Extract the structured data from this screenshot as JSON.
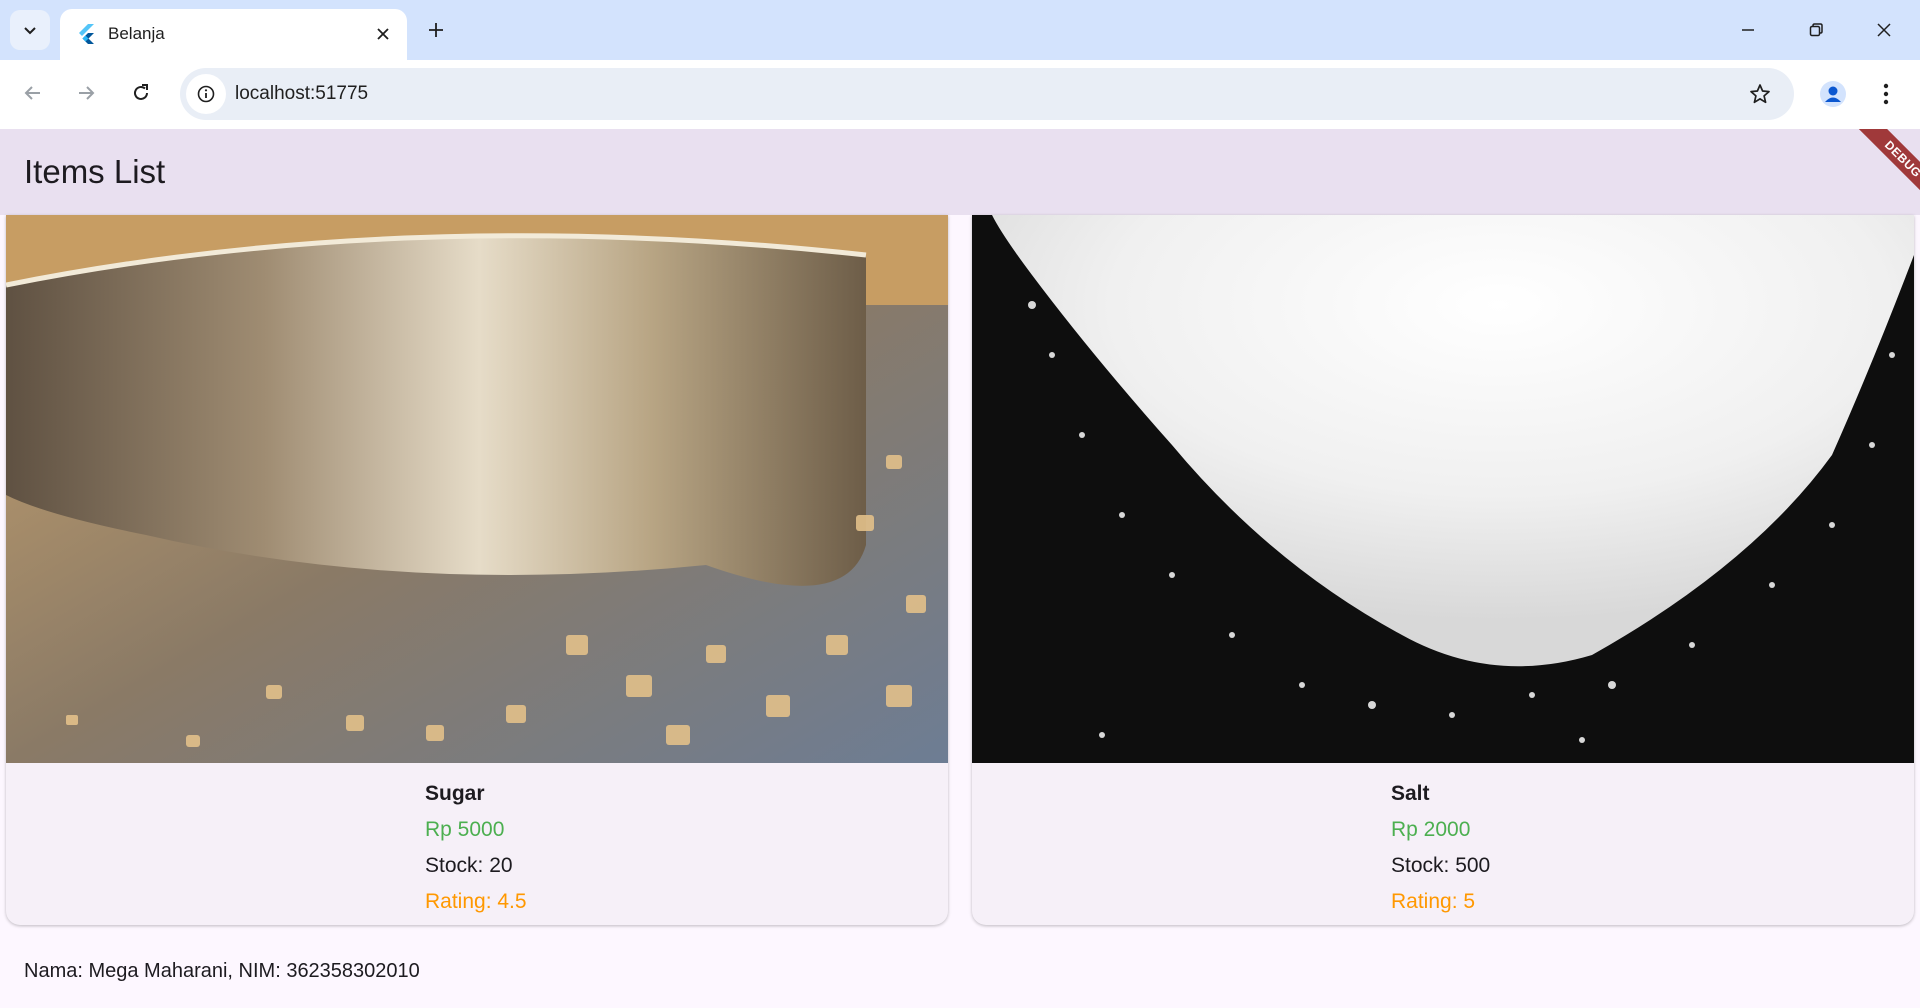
{
  "browser": {
    "tab_title": "Belanja",
    "url": "localhost:51775"
  },
  "app": {
    "title": "Items List",
    "debug_label": "DEBUG"
  },
  "items": [
    {
      "name": "Sugar",
      "price": "Rp 5000",
      "stock": "Stock: 20",
      "rating": "Rating: 4.5"
    },
    {
      "name": "Salt",
      "price": "Rp 2000",
      "stock": "Stock: 500",
      "rating": "Rating: 5"
    }
  ],
  "footer": {
    "text": "Nama: Mega Maharani, NIM: 362358302010"
  },
  "colors": {
    "price": "#4caf50",
    "rating": "#ff9800",
    "appbar": "#e9e0f0",
    "debug": "#a0393a"
  },
  "icons": [
    "tab-search-icon",
    "flutter-favicon-icon",
    "close-icon",
    "plus-icon",
    "minimize-icon",
    "restore-icon",
    "back-icon",
    "forward-icon",
    "reload-icon",
    "site-info-icon",
    "star-icon",
    "profile-icon",
    "more-vert-icon"
  ]
}
